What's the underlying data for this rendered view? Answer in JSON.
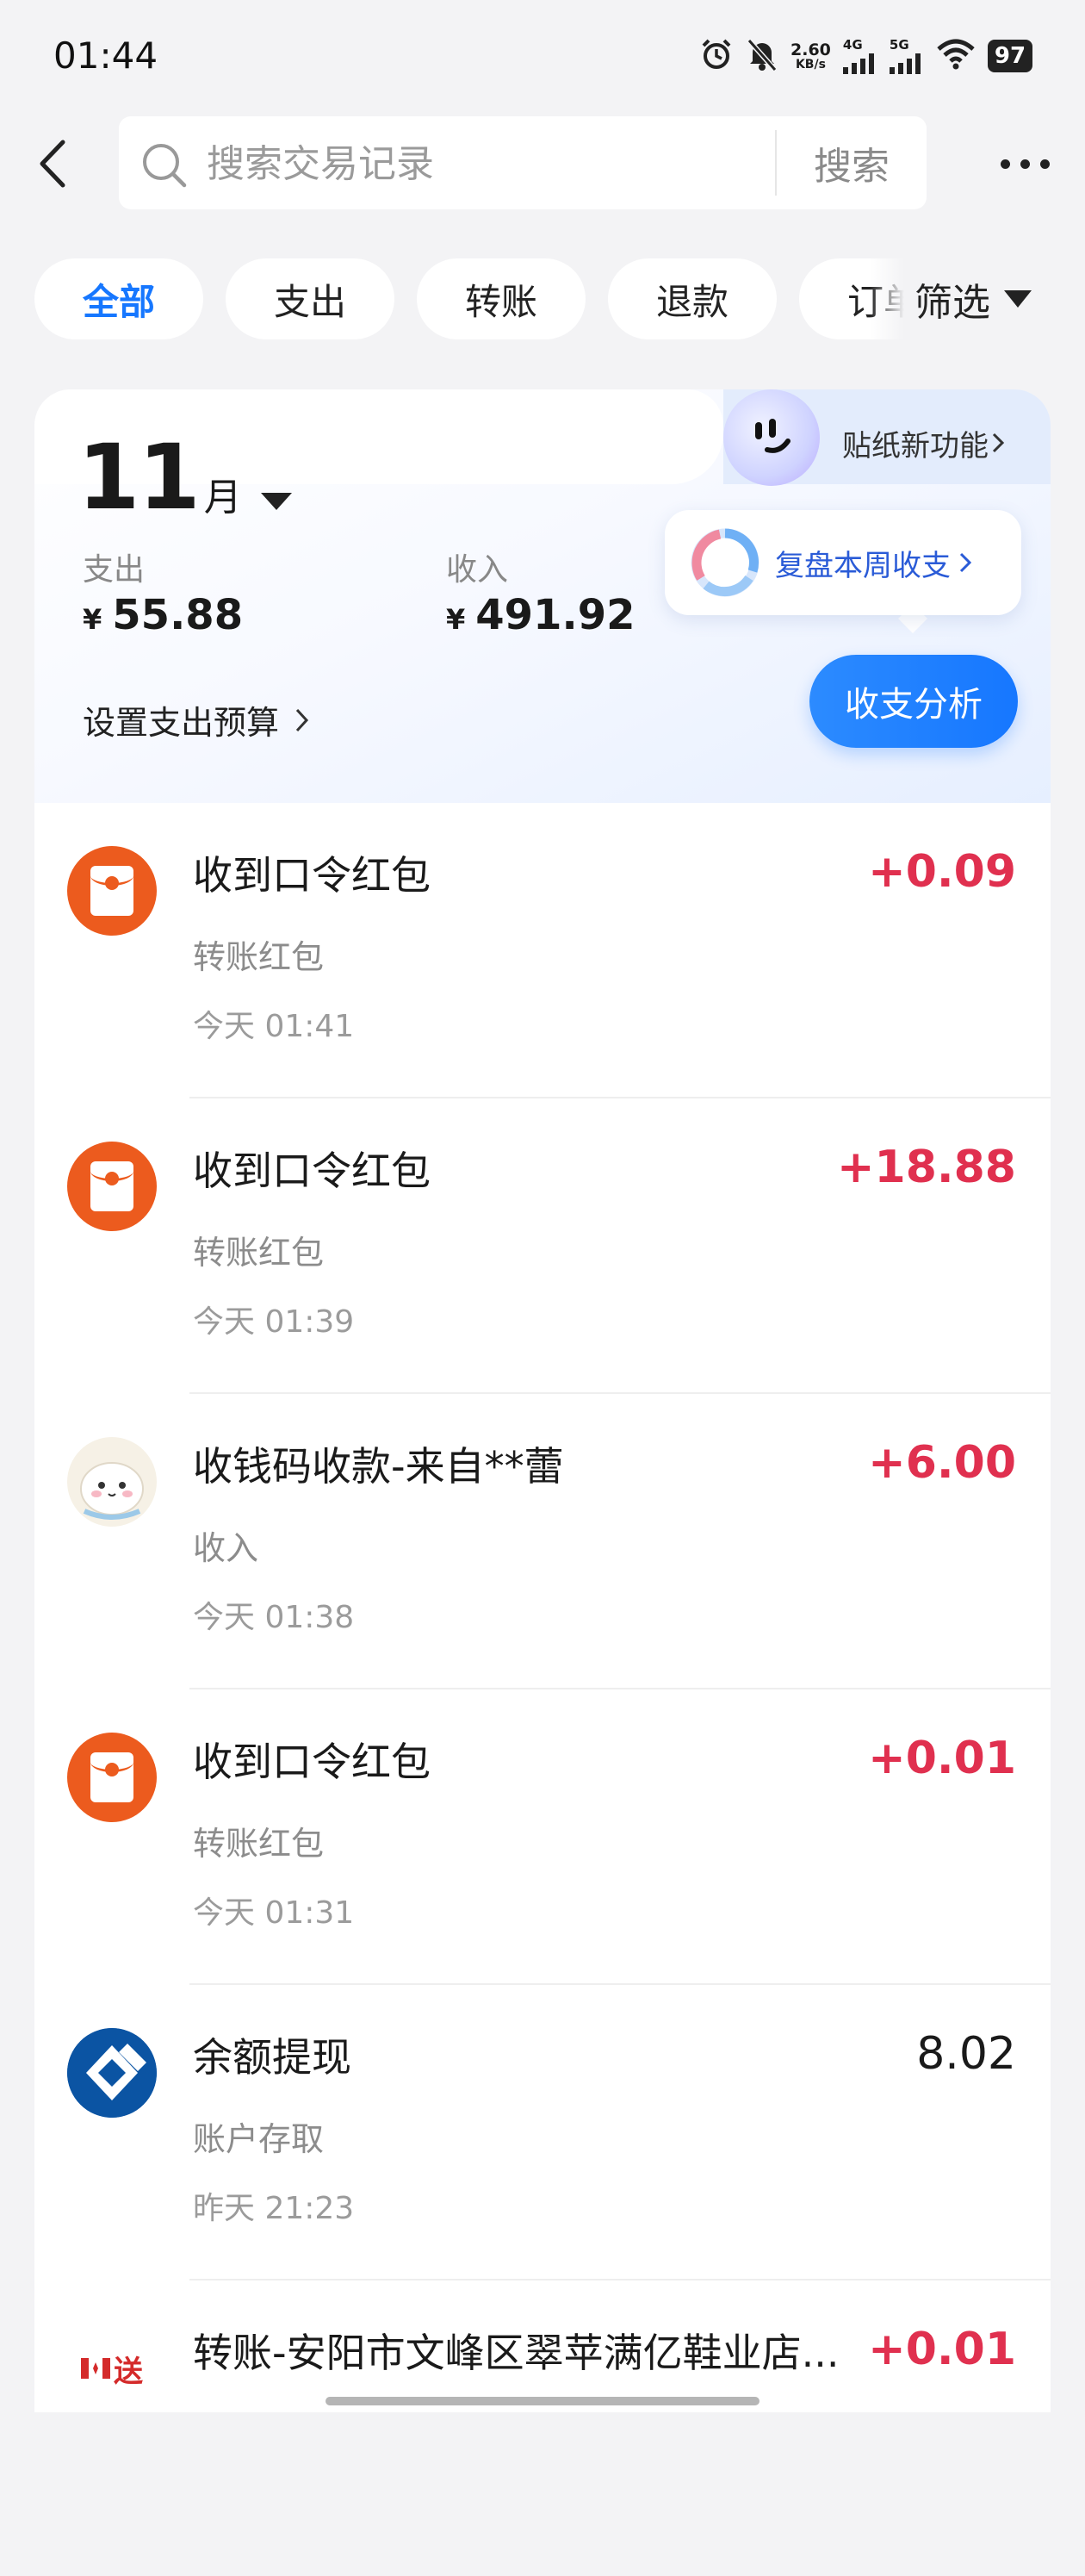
{
  "status_bar": {
    "time": "01:44",
    "net_speed_value": "2.60",
    "net_speed_unit": "KB/s",
    "sig1_label": "4G",
    "sig2_label": "5G",
    "battery": "97"
  },
  "search": {
    "placeholder": "搜索交易记录",
    "button_label": "搜索"
  },
  "filters": {
    "tabs": [
      "全部",
      "支出",
      "转账",
      "退款",
      "订单"
    ],
    "active_index": 0,
    "filter_label": "筛选"
  },
  "summary": {
    "sticker_label": "贴纸新功能",
    "month_number": "11",
    "month_unit": "月",
    "expense_label": "支出",
    "expense_currency": "¥",
    "expense_amount": "55.88",
    "income_label": "收入",
    "income_currency": "¥",
    "income_amount": "491.92",
    "budget_label": "设置支出预算",
    "review_label": "复盘本周收支",
    "analysis_label": "收支分析"
  },
  "transactions": [
    {
      "title": "收到口令红包",
      "category": "转账红包",
      "time": "今天 01:41",
      "amount": "+0.09",
      "icon": "red-packet-icon"
    },
    {
      "title": "收到口令红包",
      "category": "转账红包",
      "time": "今天 01:39",
      "amount": "+18.88",
      "icon": "red-packet-icon"
    },
    {
      "title": "收钱码收款-来自**蕾",
      "category": "收入",
      "time": "今天 01:38",
      "amount": "+6.00",
      "icon": "user-avatar-icon"
    },
    {
      "title": "收到口令红包",
      "category": "转账红包",
      "time": "今天 01:31",
      "amount": "+0.01",
      "icon": "red-packet-icon"
    },
    {
      "title": "余额提现",
      "category": "账户存取",
      "time": "昨天 21:23",
      "amount": "8.02",
      "icon": "bank-icon"
    },
    {
      "title": "转账-安阳市文峰区翠苹满亿鞋业店...",
      "category": "",
      "time": "",
      "amount": "+0.01",
      "icon": "merchant-icon",
      "merchant_badge": "送"
    }
  ],
  "colors": {
    "accent": "#1677ff",
    "income_red": "#e0304f",
    "red_packet": "#ec5b1e",
    "bank_blue": "#0b54a3"
  }
}
